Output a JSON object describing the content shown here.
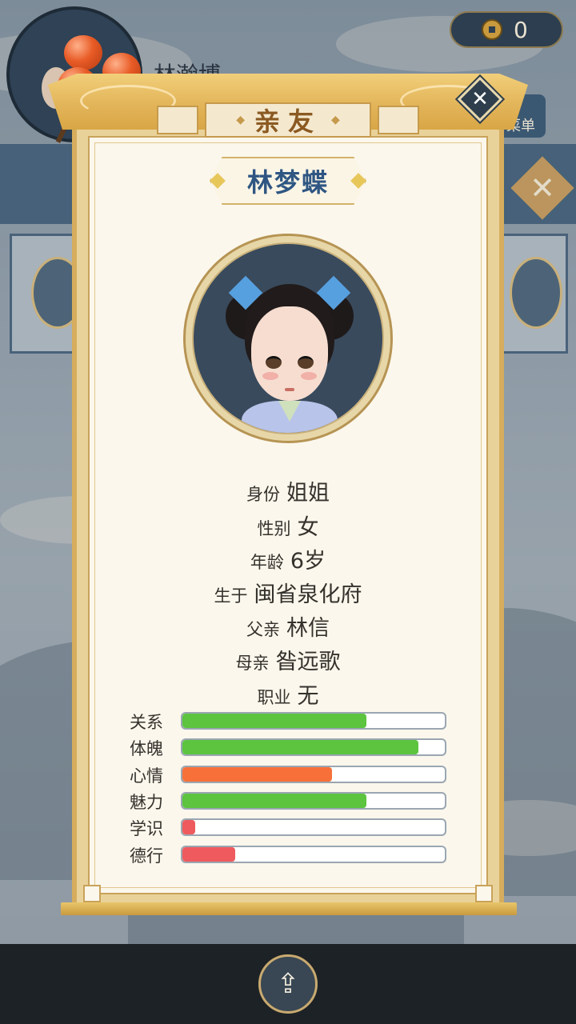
{
  "hud": {
    "player_name": "林瀚博",
    "coin_count": "0",
    "side_button_label": "菜单"
  },
  "panel": {
    "title": "亲友",
    "close_icon": "close-icon",
    "character_name": "林梦蝶"
  },
  "info": [
    {
      "label": "身份",
      "value": "姐姐"
    },
    {
      "label": "性别",
      "value": "女"
    },
    {
      "label": "年龄",
      "value": "6岁"
    },
    {
      "label": "生于",
      "value": "闽省泉化府"
    },
    {
      "label": "父亲",
      "value": "林信"
    },
    {
      "label": "母亲",
      "value": "昝远歌"
    },
    {
      "label": "职业",
      "value": "无"
    }
  ],
  "stats": [
    {
      "label": "关系",
      "level": 0.7,
      "color": "#5cc43f"
    },
    {
      "label": "体魄",
      "level": 0.9,
      "color": "#5cc43f"
    },
    {
      "label": "心情",
      "level": 0.57,
      "color": "#f7703a"
    },
    {
      "label": "魅力",
      "level": 0.7,
      "color": "#5cc43f"
    },
    {
      "label": "学识",
      "level": 0.05,
      "color": "#ee5a5d"
    },
    {
      "label": "德行",
      "level": 0.2,
      "color": "#ee5a5d"
    }
  ],
  "footer": {
    "share_icon": "share-icon"
  }
}
